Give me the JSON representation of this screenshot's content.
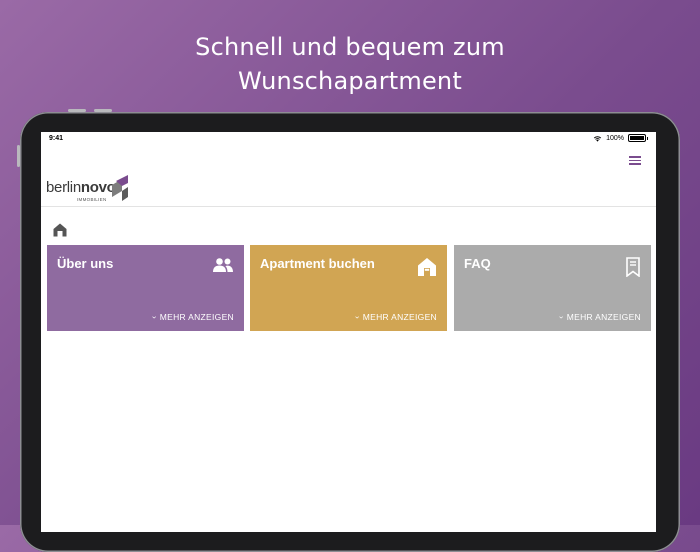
{
  "headline": {
    "line1": "Schnell und bequem zum",
    "line2": "Wunschapartment"
  },
  "statusbar": {
    "time": "9:41",
    "battery": "100%"
  },
  "logo": {
    "brand_light": "berlin",
    "brand_bold": "novo",
    "subtitle": "IMMOBILIEN"
  },
  "tiles": [
    {
      "title": "Über uns",
      "more_label": "MEHR ANZEIGEN",
      "icon": "people-icon",
      "color": "#8f6ba0"
    },
    {
      "title": "Apartment buchen",
      "more_label": "MEHR ANZEIGEN",
      "icon": "house-icon",
      "color": "#d1a553"
    },
    {
      "title": "FAQ",
      "more_label": "MEHR ANZEIGEN",
      "icon": "bookmark-icon",
      "color": "#ababab"
    }
  ],
  "colors": {
    "accent_purple": "#7a4c8e",
    "tile_about": "#8f6ba0",
    "tile_booking": "#d1a553",
    "tile_faq": "#ababab"
  }
}
